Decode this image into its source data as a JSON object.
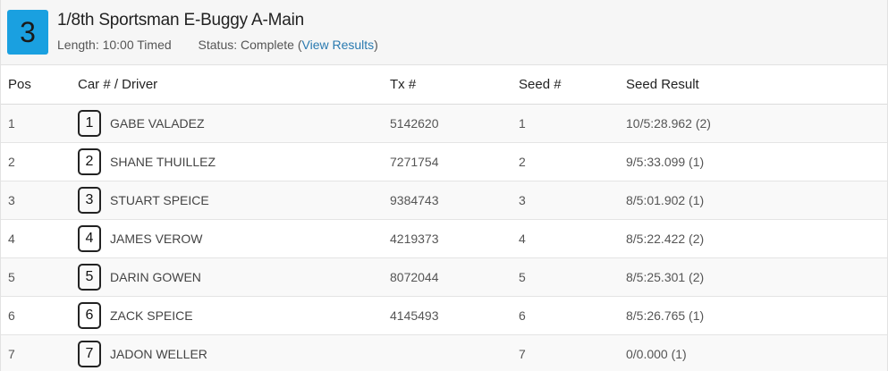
{
  "heat": {
    "number": "3",
    "title": "1/8th Sportsman E-Buggy A-Main",
    "length_text": "Length: 10:00 Timed",
    "status_text": "Status: Complete",
    "open_paren": "(",
    "view_results_link": "View Results",
    "close_paren": ")"
  },
  "table": {
    "headers": {
      "pos": "Pos",
      "car_driver": "Car # / Driver",
      "tx": "Tx #",
      "seed": "Seed #",
      "seed_result": "Seed Result"
    },
    "rows": [
      {
        "pos": "1",
        "car": "1",
        "driver": "GABE VALADEZ",
        "tx": "5142620",
        "seed": "1",
        "seed_result": "10/5:28.962 (2)"
      },
      {
        "pos": "2",
        "car": "2",
        "driver": "SHANE THUILLEZ",
        "tx": "7271754",
        "seed": "2",
        "seed_result": "9/5:33.099 (1)"
      },
      {
        "pos": "3",
        "car": "3",
        "driver": "STUART SPEICE",
        "tx": "9384743",
        "seed": "3",
        "seed_result": "8/5:01.902 (1)"
      },
      {
        "pos": "4",
        "car": "4",
        "driver": "JAMES VEROW",
        "tx": "4219373",
        "seed": "4",
        "seed_result": "8/5:22.422 (2)"
      },
      {
        "pos": "5",
        "car": "5",
        "driver": "DARIN GOWEN",
        "tx": "8072044",
        "seed": "5",
        "seed_result": "8/5:25.301 (2)"
      },
      {
        "pos": "6",
        "car": "6",
        "driver": "ZACK SPEICE",
        "tx": "4145493",
        "seed": "6",
        "seed_result": "8/5:26.765 (1)"
      },
      {
        "pos": "7",
        "car": "7",
        "driver": "JADON WELLER",
        "tx": "",
        "seed": "7",
        "seed_result": "0/0.000 (1)"
      }
    ]
  },
  "colors": {
    "badge_bg": "#1aa0e0",
    "link": "#2a7ab0"
  }
}
